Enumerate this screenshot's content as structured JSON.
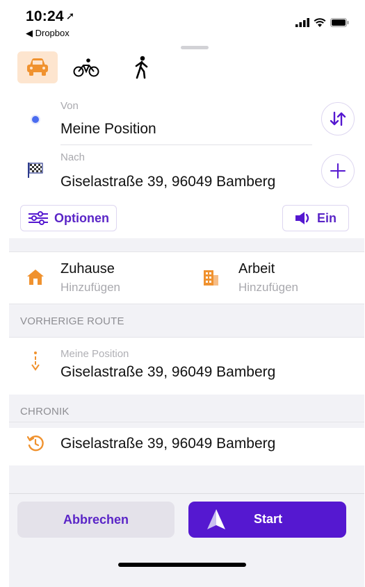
{
  "status_bar": {
    "time": "10:24",
    "back_app": "Dropbox"
  },
  "transport_modes": [
    {
      "name": "car",
      "active": true
    },
    {
      "name": "bike",
      "active": false
    },
    {
      "name": "walk",
      "active": false
    }
  ],
  "route": {
    "from_label": "Von",
    "from_value": "Meine Position",
    "to_label": "Nach",
    "to_value": "Giselastraße 39, 96049 Bamberg"
  },
  "options_button": "Optionen",
  "sound_button": "Ein",
  "favorites": {
    "home_title": "Zuhause",
    "home_sub": "Hinzufügen",
    "work_title": "Arbeit",
    "work_sub": "Hinzufügen"
  },
  "previous_route": {
    "header": "VORHERIGE ROUTE",
    "from": "Meine Position",
    "to": "Giselastraße 39, 96049 Bamberg"
  },
  "history": {
    "header": "CHRONIK",
    "item": "Giselastraße 39, 96049 Bamberg"
  },
  "actions": {
    "cancel": "Abbrechen",
    "start": "Start"
  },
  "colors": {
    "accent": "#5518d0",
    "orange": "#f0922f",
    "blue_dot": "#4a6cf0"
  }
}
